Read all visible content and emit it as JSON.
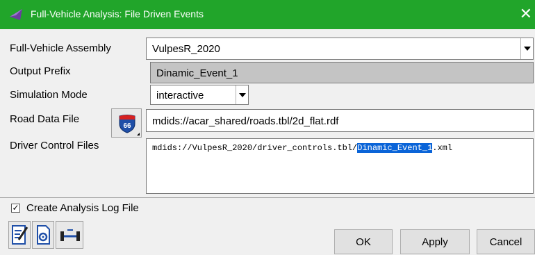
{
  "window": {
    "title": "Full-Vehicle Analysis: File Driven Events",
    "close_glyph": "✕",
    "accent_color": "#21a52a"
  },
  "form": {
    "assembly": {
      "label": "Full-Vehicle Assembly",
      "value": "VulpesR_2020"
    },
    "output_prefix": {
      "label": "Output Prefix",
      "value": "Dinamic_Event_1"
    },
    "simulation_mode": {
      "label": "Simulation Mode",
      "value": "interactive"
    },
    "road_data": {
      "label": "Road Data File",
      "value": "mdids://acar_shared/roads.tbl/2d_flat.rdf",
      "icon_text": "66"
    },
    "driver_control": {
      "label": "Driver Control Files",
      "value_prefix": "mdids://VulpesR_2020/driver_controls.tbl/",
      "value_selected": "Dinamic_Event_1",
      "value_suffix": ".xml"
    }
  },
  "options": {
    "create_log": {
      "label": "Create Analysis Log File",
      "checked": true,
      "check_glyph": "✓"
    }
  },
  "toolbar": {
    "icons": [
      "notes-icon",
      "file-settings-icon",
      "vehicle-icon"
    ]
  },
  "buttons": {
    "ok": "OK",
    "apply": "Apply",
    "cancel": "Cancel"
  }
}
